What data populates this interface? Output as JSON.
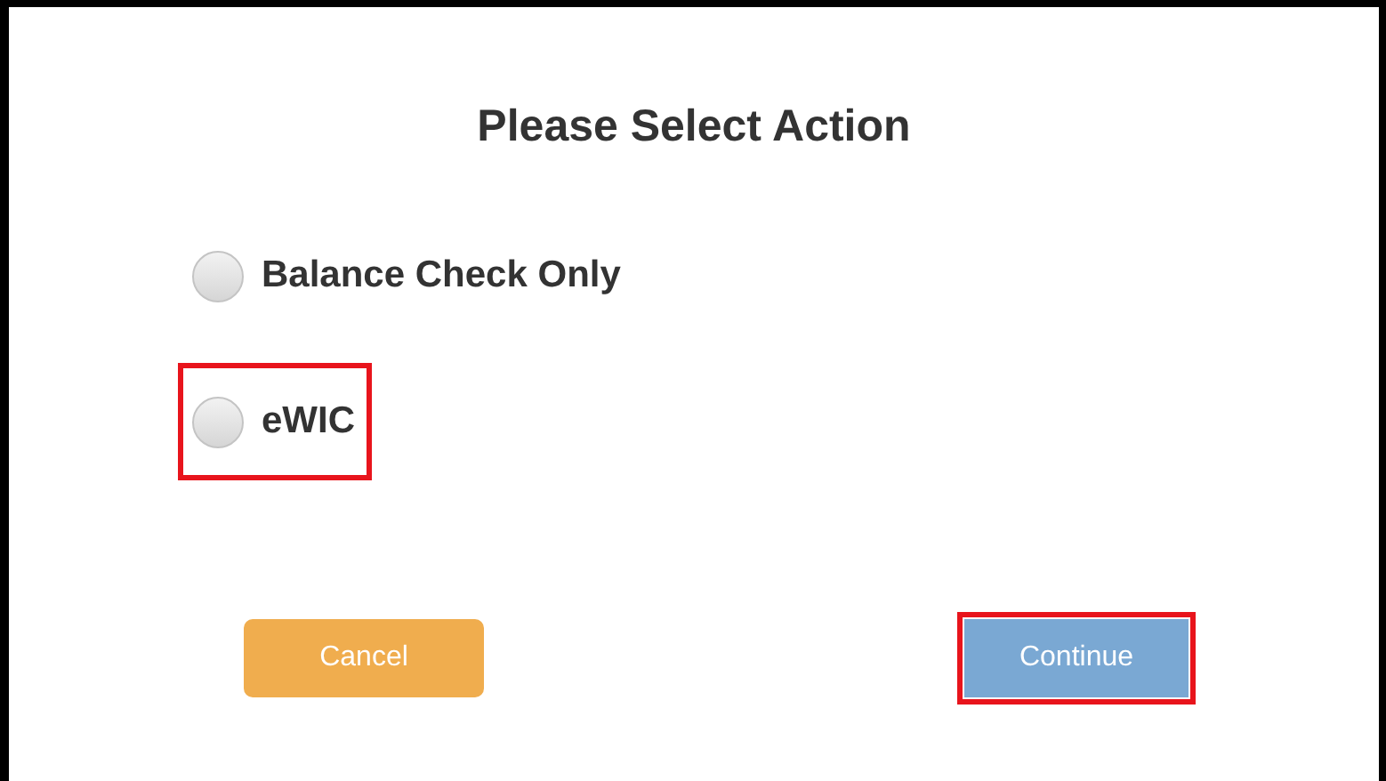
{
  "dialog": {
    "title": "Please Select Action"
  },
  "options": [
    {
      "label": "Balance Check Only",
      "selected": false,
      "highlighted": false
    },
    {
      "label": "eWIC",
      "selected": false,
      "highlighted": true
    }
  ],
  "buttons": [
    {
      "kind": "cancel",
      "label": "Cancel",
      "highlighted": false
    },
    {
      "kind": "continue",
      "label": "Continue",
      "highlighted": true
    }
  ]
}
